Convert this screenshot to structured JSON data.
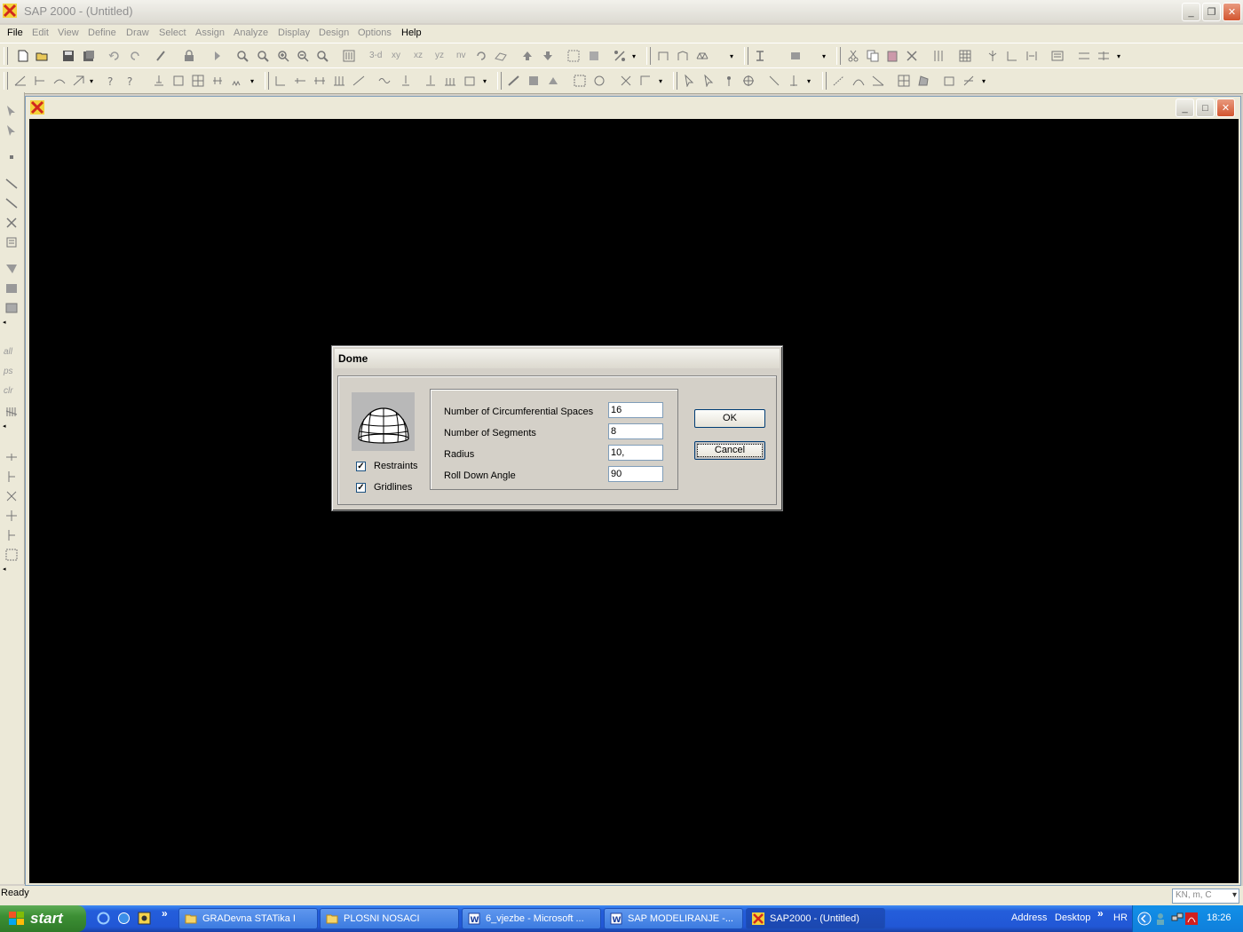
{
  "window": {
    "title": "SAP 2000 - (Untitled)"
  },
  "menu": [
    "File",
    "Edit",
    "View",
    "Define",
    "Draw",
    "Select",
    "Assign",
    "Analyze",
    "Display",
    "Design",
    "Options",
    "Help"
  ],
  "toolbar": {
    "view_buttons": [
      "3-d",
      "xy",
      "xz",
      "yz",
      "nv"
    ]
  },
  "left_toolbar_labels": [
    "all",
    "ps",
    "clr"
  ],
  "dialog": {
    "title": "Dome",
    "checkboxes": [
      {
        "label": "Restraints",
        "checked": true
      },
      {
        "label": "Gridlines",
        "checked": true
      }
    ],
    "fields": [
      {
        "label": "Number of Circumferential Spaces",
        "value": "16"
      },
      {
        "label": "Number of Segments",
        "value": "8"
      },
      {
        "label": "Radius",
        "value": "10,"
      },
      {
        "label": "Roll Down Angle",
        "value": "90"
      }
    ],
    "ok_label": "OK",
    "cancel_label": "Cancel"
  },
  "status": {
    "text": "Ready",
    "units": "KN, m, C"
  },
  "taskbar": {
    "start_label": "start",
    "tasks": [
      {
        "label": "GRADevna  STATika  I",
        "icon": "folder-icon"
      },
      {
        "label": "PLOSNI  NOSACI",
        "icon": "folder-icon"
      },
      {
        "label": "6_vjezbe - Microsoft ...",
        "icon": "word-icon"
      },
      {
        "label": "SAP  MODELIRANJE -...",
        "icon": "word-icon"
      },
      {
        "label": "SAP2000 - (Untitled)",
        "icon": "sap-icon"
      }
    ],
    "address_label": "Address",
    "desktop_label": "Desktop",
    "language": "HR",
    "clock": "18:26"
  },
  "colors": {
    "canvas": "#000000",
    "taskbar": "#245edb",
    "start": "#3c8f34"
  }
}
